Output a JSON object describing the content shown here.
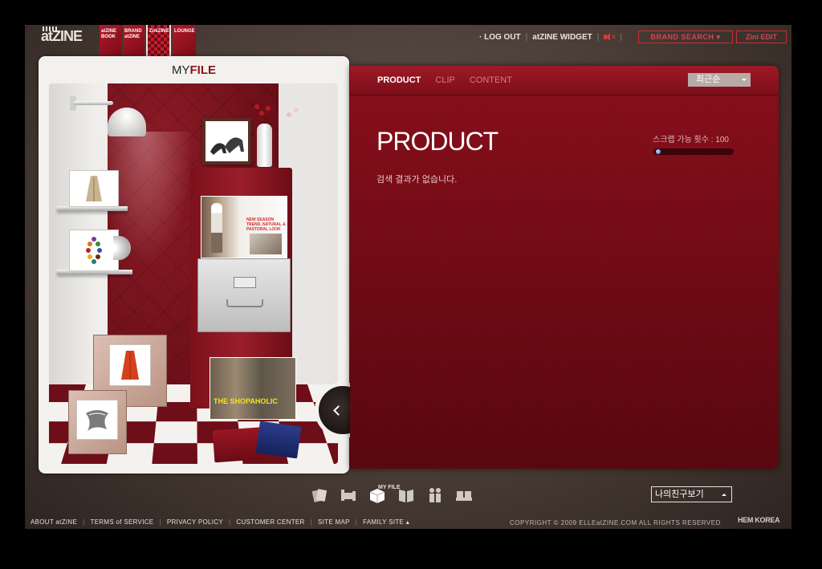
{
  "brand": {
    "logo": "atZINE"
  },
  "top_tabs": [
    {
      "label": "atZINE BOOK"
    },
    {
      "label": "BRAND atZINE"
    },
    {
      "label": "ZiniZINE"
    },
    {
      "label": "LOUNGE"
    }
  ],
  "top_links": {
    "logout": "· LOG OUT",
    "widget": "atZINE WIDGET",
    "sound_mute": "x",
    "brand_search": "BRAND SEARCH ▾",
    "zini_edit": "Zini EDIT"
  },
  "myfile": {
    "title_prefix": "MY",
    "title_highlight": "FILE",
    "magazine1_text": "NEW SEASON TREND, NATURAL & PASTORAL LOOK",
    "magazine2_text": "THE SHOPAHOLIC"
  },
  "content": {
    "tabs": [
      {
        "label": "PRODUCT",
        "active": true
      },
      {
        "label": "CLIP",
        "active": false
      },
      {
        "label": "CONTENT",
        "active": false
      }
    ],
    "sort_selected": "최근순",
    "section_title": "PRODUCT",
    "no_results": "검색 결과가 없습니다.",
    "scrap_label": "스크랩 가능 횟수   : 100",
    "scrap_count": 100
  },
  "bottom": {
    "icons": [
      "scrap-cards-icon",
      "bed-icon",
      "my-file-box-icon",
      "book-icon",
      "people-icon",
      "lounge-sofa-icon"
    ],
    "active_label": "MY FILE",
    "friend_select": "나의친구보기"
  },
  "footer": {
    "links": [
      "ABOUT atZINE",
      "TERMS of SERVICE",
      "PRIVACY POLICY",
      "CUSTOMER CENTER",
      "SITE MAP",
      "FAMILY SITE ▴"
    ],
    "copyright": "COPYRIGHT  ©  2009  ELLEatZINE.COM  ALL RIGHTS RESERVED",
    "company": "HEM KOREA"
  },
  "colors": {
    "accent_red": "#8c1420",
    "panel_red": "#6d0a14",
    "link_red": "#d0484f"
  }
}
